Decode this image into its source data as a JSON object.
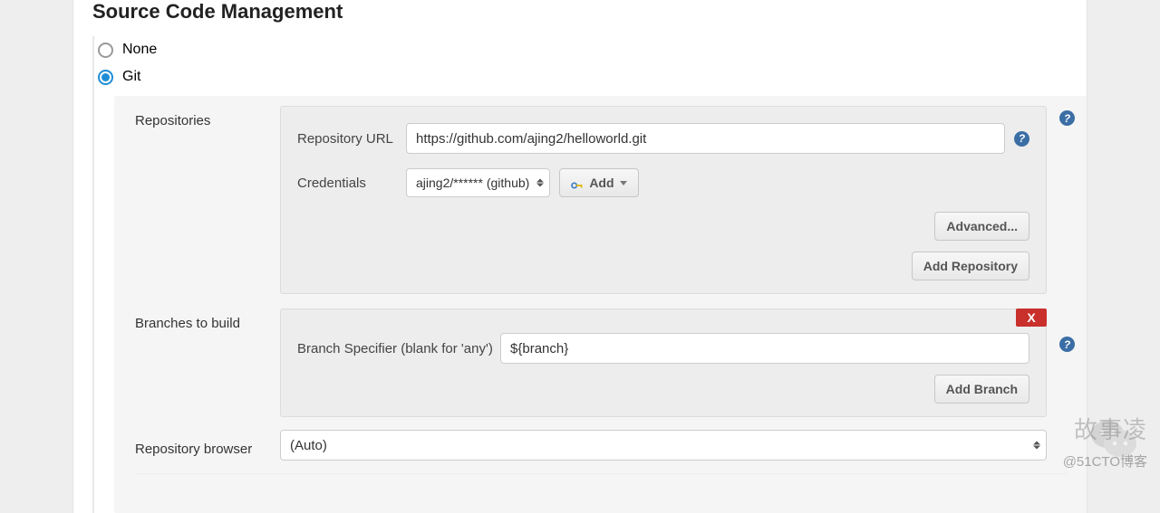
{
  "section_title": "Source Code Management",
  "scm_options": {
    "none": "None",
    "git": "Git"
  },
  "repositories": {
    "label": "Repositories",
    "url_label": "Repository URL",
    "url_value": "https://github.com/ajing2/helloworld.git",
    "credentials_label": "Credentials",
    "credentials_value": "ajing2/****** (github)",
    "add_label": "Add",
    "advanced_label": "Advanced...",
    "add_repo_label": "Add Repository"
  },
  "branches": {
    "label": "Branches to build",
    "specifier_label": "Branch Specifier (blank for 'any')",
    "specifier_value": "${branch}",
    "add_branch_label": "Add Branch",
    "delete_label": "X"
  },
  "repo_browser": {
    "label": "Repository browser",
    "value": "(Auto)"
  },
  "watermark": {
    "name": "故事凌",
    "sub": "@51CTO博客"
  },
  "help_glyph": "?"
}
